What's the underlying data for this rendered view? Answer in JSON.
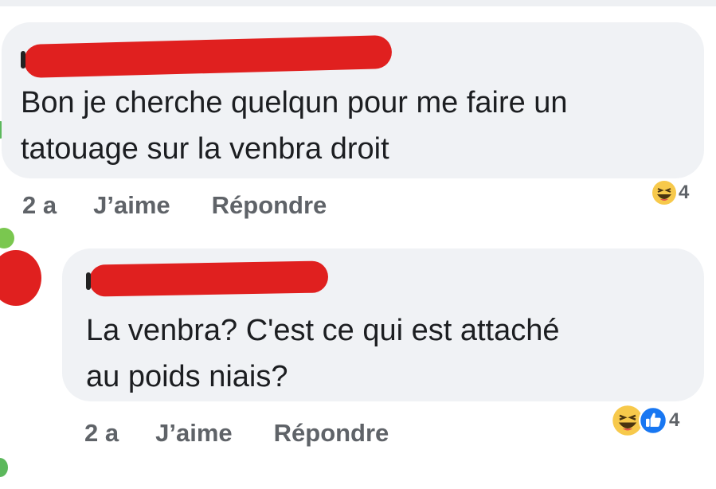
{
  "comments": [
    {
      "text_line1": "Bon je cherche quelqun  pour me faire un",
      "text_line2": "tatouage sur la venbra droit",
      "time": "2 a",
      "like_label": "J’aime",
      "reply_label": "Répondre",
      "reaction_count": "4",
      "reactions": [
        "haha-icon"
      ]
    },
    {
      "text_line1": "La venbra? C'est ce qui est attaché",
      "text_line2": "au poids niais?",
      "time": "2 a",
      "like_label": "J’aime",
      "reply_label": "Répondre",
      "reaction_count": "4",
      "reactions": [
        "haha-icon",
        "like-icon"
      ]
    }
  ],
  "colors": {
    "bubble": "#f0f2f5",
    "redaction": "#e0201f",
    "meta_text": "#5f6368",
    "like_blue": "#1877f2",
    "haha_yellow": "#f7c94b"
  }
}
